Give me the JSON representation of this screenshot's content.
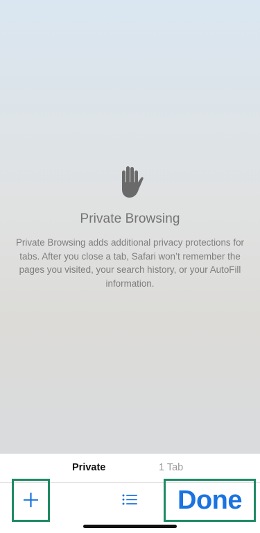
{
  "private_browsing": {
    "icon": "hand-raised-icon",
    "title": "Private Browsing",
    "description": "Private Browsing adds additional privacy protections for tabs. After you close a tab, Safari won’t remember the pages you visited, your search history, or your AutoFill information."
  },
  "tab_groups": {
    "private_label": "Private",
    "tab_count_label": "1 Tab"
  },
  "toolbar": {
    "new_tab_icon": "plus-icon",
    "tab_overview_icon": "list-icon",
    "done_label": "Done"
  },
  "colors": {
    "accent": "#1a73e0",
    "highlight_border": "#1f8a63"
  }
}
